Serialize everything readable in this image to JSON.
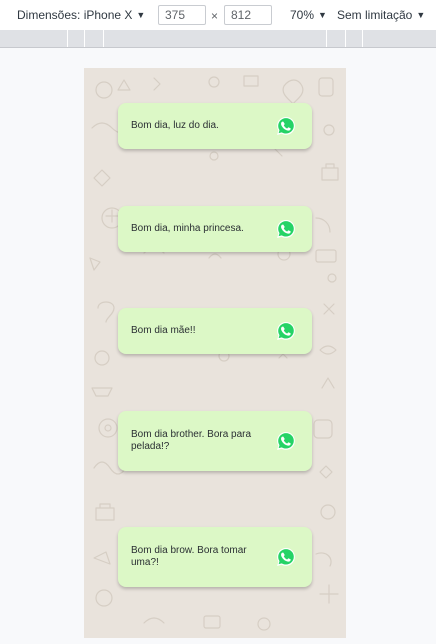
{
  "devtools": {
    "device_label": "Dimensões: iPhone X",
    "width_value": "375",
    "times_sign": "×",
    "height_value": "812",
    "zoom_label": "70%",
    "throttle_label": "Sem limitação"
  },
  "messages": [
    {
      "text": "Bom dia, luz do dia.",
      "icon": "whatsapp-icon"
    },
    {
      "text": "Bom dia, minha princesa.",
      "icon": "whatsapp-icon"
    },
    {
      "text": "Bom dia mãe!!",
      "icon": "whatsapp-icon"
    },
    {
      "text": "Bom dia brother. Bora para pelada!?",
      "icon": "whatsapp-icon"
    },
    {
      "text": "Bom dia brow. Bora tomar uma?!",
      "icon": "whatsapp-icon"
    }
  ],
  "colors": {
    "card_background": "#dcf8c6",
    "viewport_background": "#e9e3dc",
    "whatsapp_green": "#25d366"
  }
}
